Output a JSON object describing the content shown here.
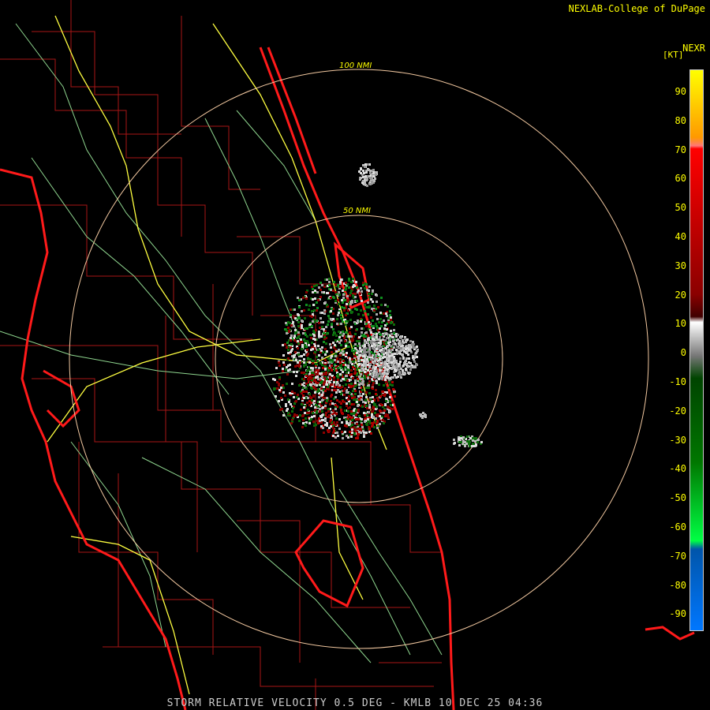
{
  "header": {
    "credit": "NEXLAB-College of DuPage",
    "product": "NEXR",
    "units": "[KT]"
  },
  "footer": "STORM RELATIVE VELOCITY 0.5 DEG - KMLB 10 DEC 25 04:36",
  "range_rings": [
    {
      "label": "100 NMI"
    },
    {
      "label": "50 NMI"
    }
  ],
  "legend": {
    "ticks": [
      "90",
      "80",
      "70",
      "60",
      "50",
      "40",
      "30",
      "20",
      "10",
      "0",
      "-10",
      "-20",
      "-30",
      "-40",
      "-50",
      "-60",
      "-70",
      "-80",
      "-90"
    ]
  },
  "colors": {
    "border": "#ff1a1a",
    "county": "#b01818",
    "road_major": "#ffff40",
    "road_minor": "#9adf9a",
    "ring": "#f2c8a0",
    "text": "#ffff00"
  }
}
